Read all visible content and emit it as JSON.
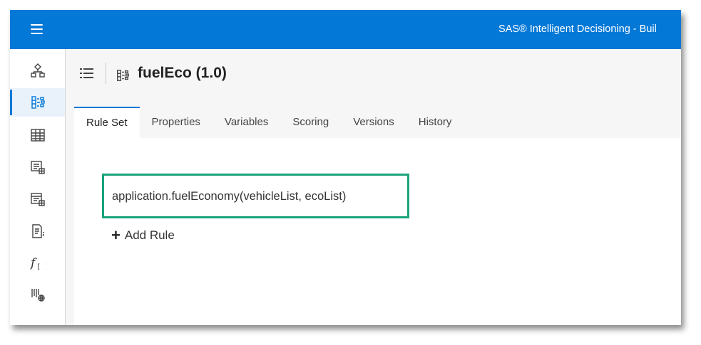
{
  "app": {
    "title": "SAS® Intelligent Decisioning - Buil",
    "menu_icon": "hamburger-menu-icon"
  },
  "sidebar": {
    "items": [
      {
        "icon": "decision-flow-icon",
        "active": false
      },
      {
        "icon": "rule-set-icon",
        "active": true
      },
      {
        "icon": "table-icon",
        "active": false
      },
      {
        "icon": "data-grid-icon",
        "active": false
      },
      {
        "icon": "lookup-table-icon",
        "active": false
      },
      {
        "icon": "code-file-icon",
        "active": false
      },
      {
        "icon": "function-icon",
        "active": false,
        "label": "f[]"
      },
      {
        "icon": "global-variables-icon",
        "active": false
      }
    ]
  },
  "header": {
    "list_icon": "list-icon",
    "object_icon": "rule-set-icon",
    "title": "fuelEco (1.0)"
  },
  "tabs": [
    {
      "label": "Rule Set",
      "active": true
    },
    {
      "label": "Properties",
      "active": false
    },
    {
      "label": "Variables",
      "active": false
    },
    {
      "label": "Scoring",
      "active": false
    },
    {
      "label": "Versions",
      "active": false
    },
    {
      "label": "History",
      "active": false
    }
  ],
  "rules": {
    "items": [
      {
        "text": "application.fuelEconomy(vehicleList, ecoList)"
      }
    ],
    "add_label": "Add Rule",
    "add_icon": "plus-icon"
  },
  "colors": {
    "brand": "#0478d7",
    "highlight": "#1aa37c"
  }
}
